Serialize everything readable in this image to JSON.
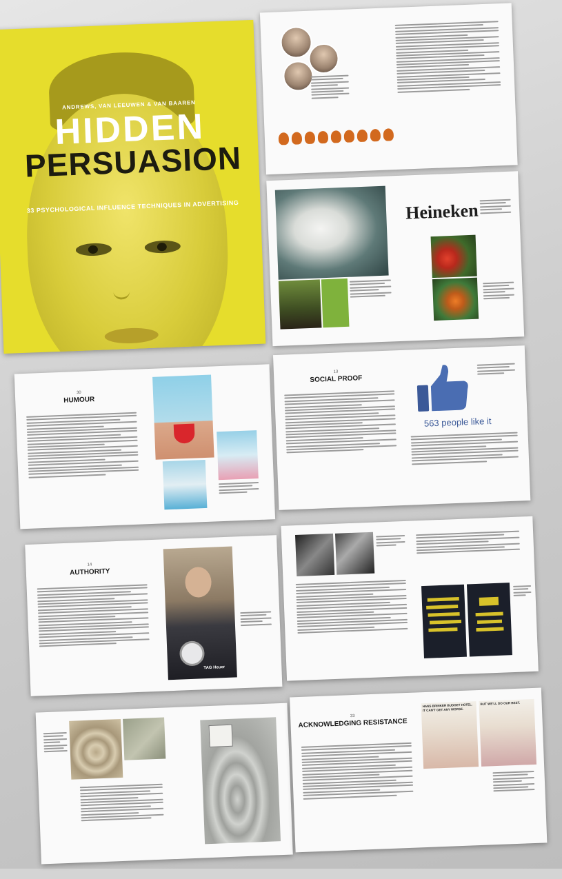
{
  "cover": {
    "authors": "ANDREWS, VAN LEEUWEN & VAN BAAREN",
    "title_line1": "HIDDEN",
    "title_line2": "PERSUASION",
    "subtitle": "33 PSYCHOLOGICAL INFLUENCE TECHNIQUES IN ADVERTISING"
  },
  "spreads": {
    "heineken": {
      "brand": "Heineken"
    },
    "humour": {
      "number": "30",
      "title": "HUMOUR"
    },
    "social_proof": {
      "number": "13",
      "title": "SOCIAL PROOF",
      "like_count": "563 people like it"
    },
    "authority": {
      "number": "14",
      "title": "AUTHORITY",
      "watch_brand": "TAG Heuer"
    },
    "acknowledging": {
      "number": "33",
      "title": "ACKNOWLEDGING RESISTANCE"
    },
    "ad_headlines": {
      "left": "HANS BRINKER BUDGET HOTEL. IT CAN'T GET ANY WORSE.",
      "right": "BUT WE'LL DO OUR BEST."
    }
  },
  "colors": {
    "cover_yellow": "#e6dd2c",
    "facebook_blue": "#3b5998",
    "wwf_green": "#7fb23c",
    "swimsuit_red": "#d9262c"
  }
}
